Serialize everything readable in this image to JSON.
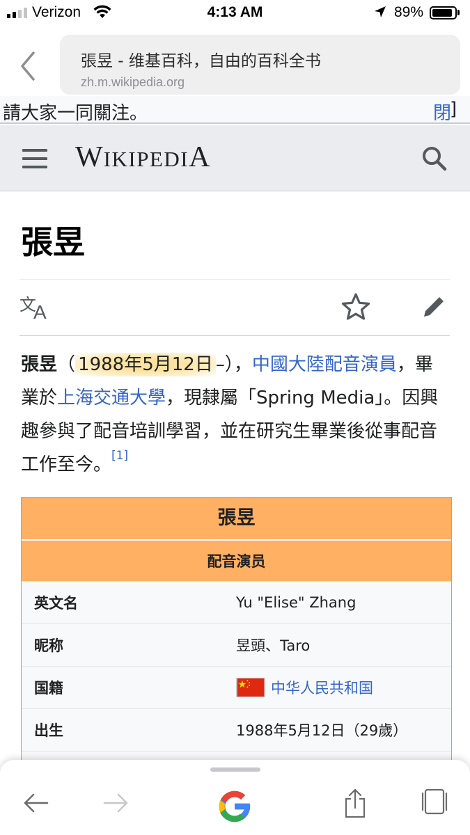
{
  "status_bar": {
    "carrier": "Verizon",
    "time": "4:13 AM",
    "battery_percent": "89%",
    "battery_level": 0.89,
    "signal_bars": 2
  },
  "browser": {
    "page_title": "張昱 - 维基百科，自由的百科全书",
    "domain": "zh.m.wikipedia.org"
  },
  "site_notice": {
    "text": "請大家一同關注。",
    "link_fragment": "閉",
    "bracket": "]"
  },
  "header": {
    "wordmark_big_w": "W",
    "wordmark_small": "IKIPEDI",
    "wordmark_big_a": "A"
  },
  "article": {
    "title": "張昱",
    "lead": {
      "name": "張昱",
      "open_paren": "（",
      "birth_date": "1988年5月12日",
      "dash_close": "–），",
      "link_occupation": "中國大陸配音演員",
      "text_graduated": "，畢業於",
      "link_university": "上海交通大學",
      "text_rest": "，現隸屬「Spring Media」。因興趣參與了配音培訓學習，並在研究生畢業後從事配音工作至今。",
      "ref": "[1]"
    }
  },
  "infobox": {
    "title": "張昱",
    "subtitle": "配音演员",
    "rows": [
      {
        "label": "英文名",
        "value": "Yu \"Elise\" Zhang"
      },
      {
        "label": "昵称",
        "value": "昱頭、Taro"
      },
      {
        "label": "国籍",
        "value": "中华人民共和国"
      },
      {
        "label": "出生",
        "value": "1988年5月12日（29歲）"
      }
    ]
  },
  "colors": {
    "link": "#3366cc",
    "infobox_header": "#ffb062",
    "highlight": "#fbe29e",
    "wiki_header_bg": "#eaecf0"
  }
}
